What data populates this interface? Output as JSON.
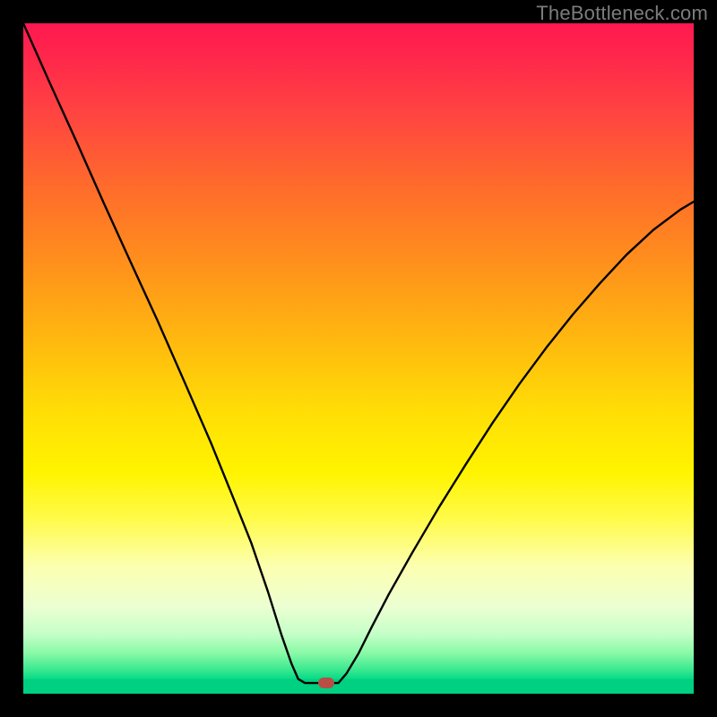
{
  "watermark": "TheBottleneck.com",
  "marker": {
    "x_frac": 0.452,
    "y_frac": 0.984
  },
  "chart_data": {
    "type": "line",
    "title": "",
    "xlabel": "",
    "ylabel": "",
    "xlim": [
      0,
      1
    ],
    "ylim": [
      0,
      1
    ],
    "note": "Axes unlabeled; values below are fractional positions within the plot area (0,0 = top-left). Single black V-shaped curve descending from top-left to a flat minimum near x≈0.41–0.47 at the bottom, then rising to the right edge at y≈0.27.",
    "series": [
      {
        "name": "bottleneck-curve",
        "points": [
          {
            "x": 0.0,
            "y": 0.0
          },
          {
            "x": 0.04,
            "y": 0.09
          },
          {
            "x": 0.08,
            "y": 0.178
          },
          {
            "x": 0.12,
            "y": 0.268
          },
          {
            "x": 0.16,
            "y": 0.356
          },
          {
            "x": 0.2,
            "y": 0.443
          },
          {
            "x": 0.24,
            "y": 0.534
          },
          {
            "x": 0.28,
            "y": 0.626
          },
          {
            "x": 0.31,
            "y": 0.7
          },
          {
            "x": 0.34,
            "y": 0.775
          },
          {
            "x": 0.365,
            "y": 0.848
          },
          {
            "x": 0.385,
            "y": 0.912
          },
          {
            "x": 0.4,
            "y": 0.955
          },
          {
            "x": 0.41,
            "y": 0.978
          },
          {
            "x": 0.42,
            "y": 0.984
          },
          {
            "x": 0.47,
            "y": 0.984
          },
          {
            "x": 0.482,
            "y": 0.97
          },
          {
            "x": 0.5,
            "y": 0.94
          },
          {
            "x": 0.52,
            "y": 0.9
          },
          {
            "x": 0.545,
            "y": 0.852
          },
          {
            "x": 0.58,
            "y": 0.79
          },
          {
            "x": 0.62,
            "y": 0.722
          },
          {
            "x": 0.66,
            "y": 0.658
          },
          {
            "x": 0.7,
            "y": 0.596
          },
          {
            "x": 0.74,
            "y": 0.538
          },
          {
            "x": 0.78,
            "y": 0.484
          },
          {
            "x": 0.82,
            "y": 0.434
          },
          {
            "x": 0.86,
            "y": 0.388
          },
          {
            "x": 0.9,
            "y": 0.345
          },
          {
            "x": 0.94,
            "y": 0.308
          },
          {
            "x": 0.98,
            "y": 0.278
          },
          {
            "x": 1.0,
            "y": 0.266
          }
        ]
      }
    ],
    "marker_point": {
      "x": 0.452,
      "y": 0.984
    }
  }
}
